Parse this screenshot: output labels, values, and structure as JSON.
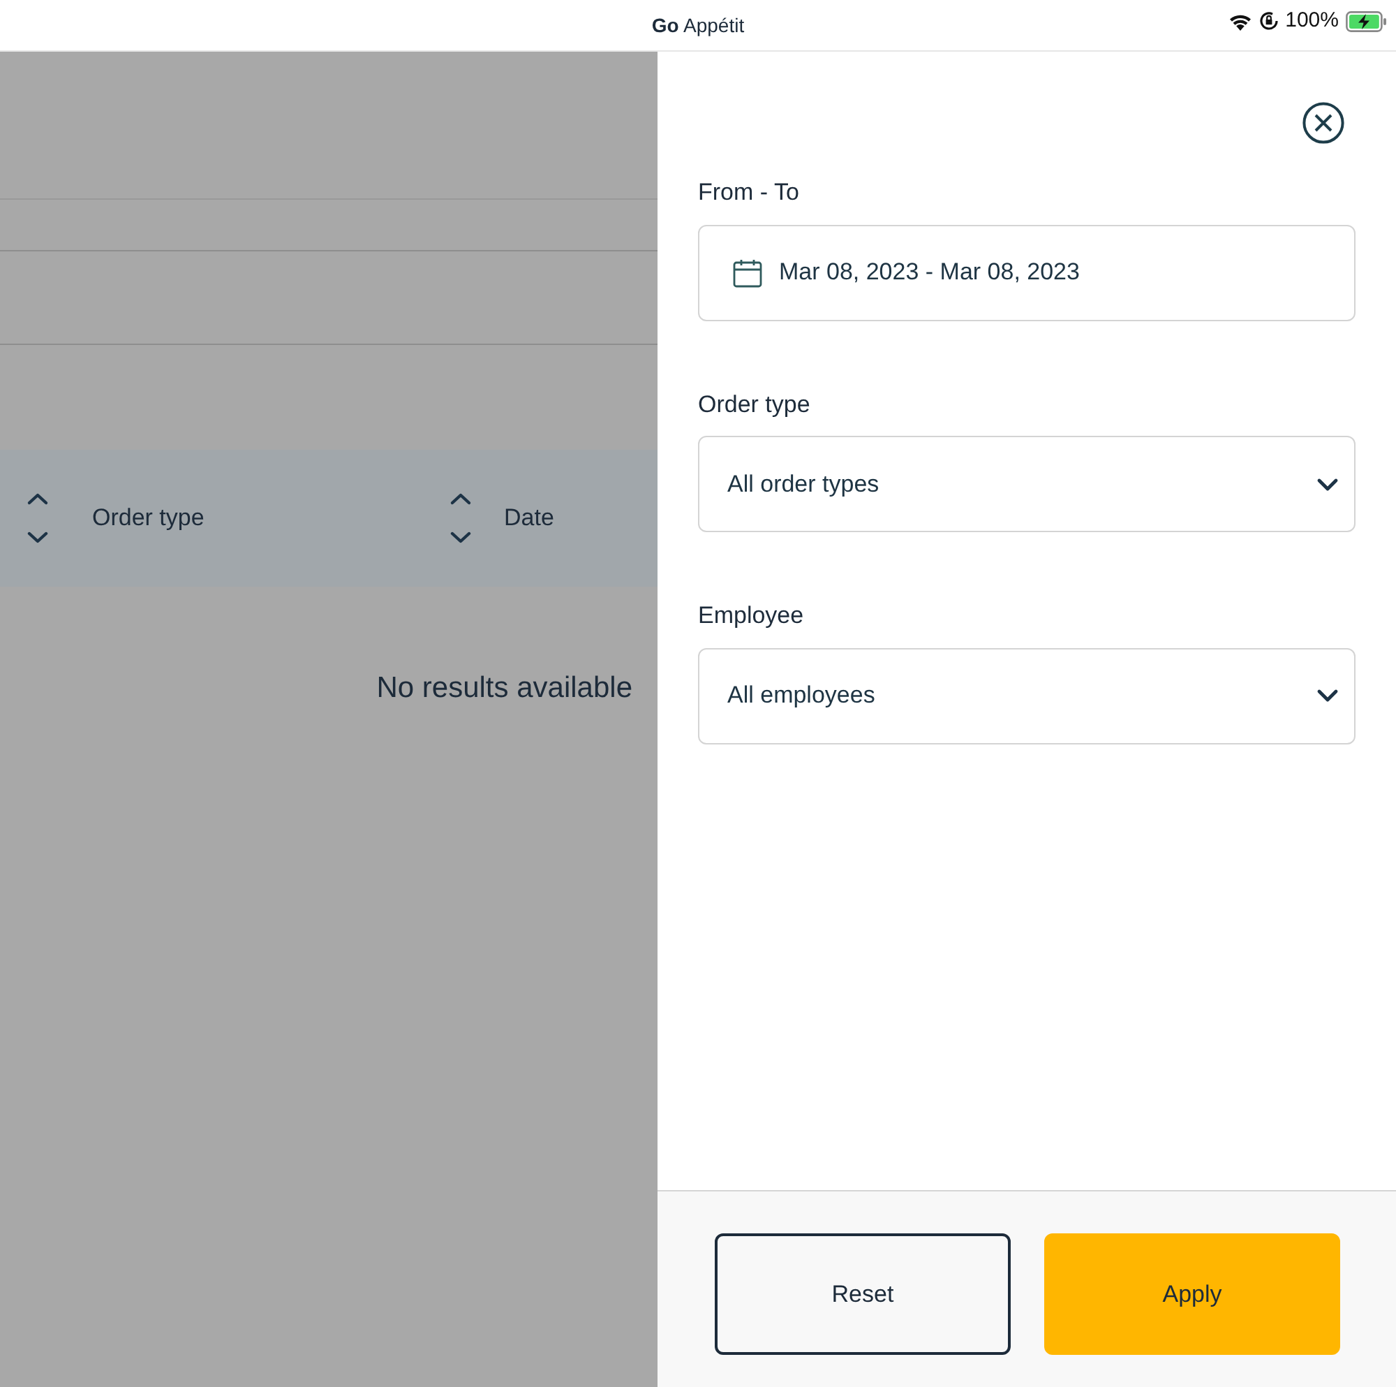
{
  "status_bar": {
    "app_title": "**Go** Appétit",
    "battery": "100%",
    "charging": true
  },
  "background": {
    "table_header": [
      {
        "label": "Order type"
      },
      {
        "label": "Date"
      }
    ],
    "empty_message": "No results available"
  },
  "filter_panel": {
    "fields": [
      {
        "label": "From - To",
        "kind": "date",
        "value": "Mar 08, 2023 - Mar 08, 2023"
      },
      {
        "label": "Order type",
        "kind": "select",
        "value": "All order types"
      },
      {
        "label": "Employee",
        "kind": "select",
        "value": "All employees"
      }
    ],
    "buttons": [
      {
        "label": "Reset",
        "kind": "secondary"
      },
      {
        "label": "Apply",
        "kind": "primary"
      }
    ]
  }
}
